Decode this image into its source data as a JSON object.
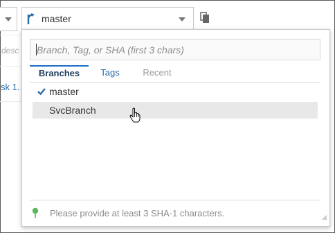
{
  "toolbar": {
    "selected_branch": "master",
    "branch_icon": "git-branch-icon",
    "copy_icon": "copy-icon"
  },
  "background": {
    "desc_fragment": "desc",
    "link_fragment": "sk 1."
  },
  "popup": {
    "search_placeholder": "Branch, Tag, or SHA (first 3 chars)",
    "tabs": [
      {
        "label": "Branches",
        "active": true
      },
      {
        "label": "Tags",
        "active": false
      },
      {
        "label": "Recent",
        "active": false
      }
    ],
    "branches": [
      {
        "name": "master",
        "checked": true
      },
      {
        "name": "SvcBranch",
        "checked": false,
        "hovered": true
      }
    ],
    "footer_message": "Please provide at least 3 SHA-1 characters.",
    "footer_icon": "pin-icon"
  },
  "colors": {
    "accent": "#1a6fc4",
    "checkmark": "#2a6aa8",
    "pin": "#5cb85c",
    "hover_row": "#e8e8e8"
  }
}
